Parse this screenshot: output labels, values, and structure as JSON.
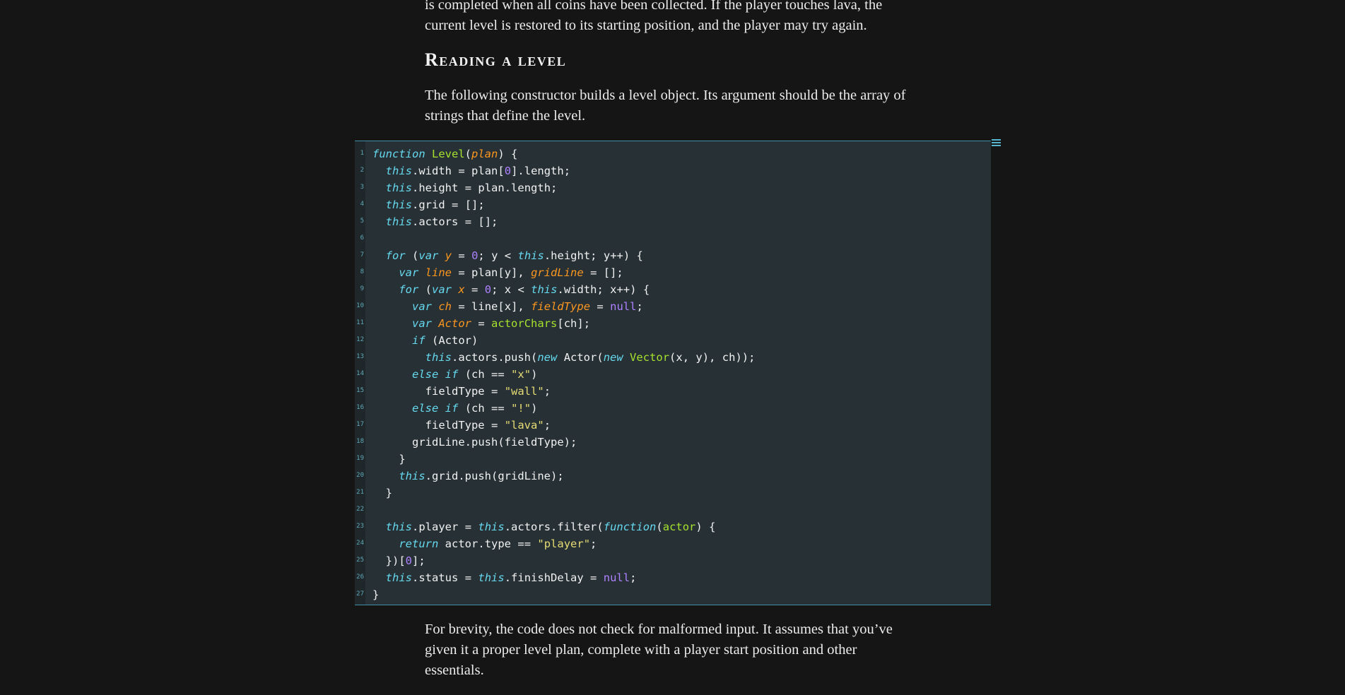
{
  "article": {
    "intro_para": "is completed when all coins have been collected. If the player touches lava, the current level is restored to its starting position, and the player may try again.",
    "section_heading": "Reading a level",
    "constructor_para": "The following constructor builds a level object. Its argument should be the array of strings that define the level.",
    "brevity_para": "For brevity, the code does not check for malformed input. It assumes that you’ve given it a proper level plan, complete with a player start position and other essentials."
  },
  "code_block": {
    "language": "javascript",
    "menu_icon": "hamburger-menu-icon",
    "lines": [
      "function Level(plan) {",
      "  this.width = plan[0].length;",
      "  this.height = plan.length;",
      "  this.grid = [];",
      "  this.actors = [];",
      "",
      "  for (var y = 0; y < this.height; y++) {",
      "    var line = plan[y], gridLine = [];",
      "    for (var x = 0; x < this.width; x++) {",
      "      var ch = line[x], fieldType = null;",
      "      var Actor = actorChars[ch];",
      "      if (Actor)",
      "        this.actors.push(new Actor(new Vector(x, y), ch));",
      "      else if (ch == \"x\")",
      "        fieldType = \"wall\";",
      "      else if (ch == \"!\")",
      "        fieldType = \"lava\";",
      "      gridLine.push(fieldType);",
      "    }",
      "    this.grid.push(gridLine);",
      "  }",
      "",
      "  this.player = this.actors.filter(function(actor) {",
      "    return actor.type == \"player\";",
      "  })[0];",
      "  this.status = this.finishDelay = null;",
      "}"
    ]
  },
  "colors": {
    "page_background": "#151515",
    "code_background": "#263035",
    "keyword": "#66d9ef",
    "function_name": "#a6e22e",
    "variable": "#fd971f",
    "number": "#ae81ff",
    "string": "#e6db74",
    "accent": "#3f8fa6"
  }
}
